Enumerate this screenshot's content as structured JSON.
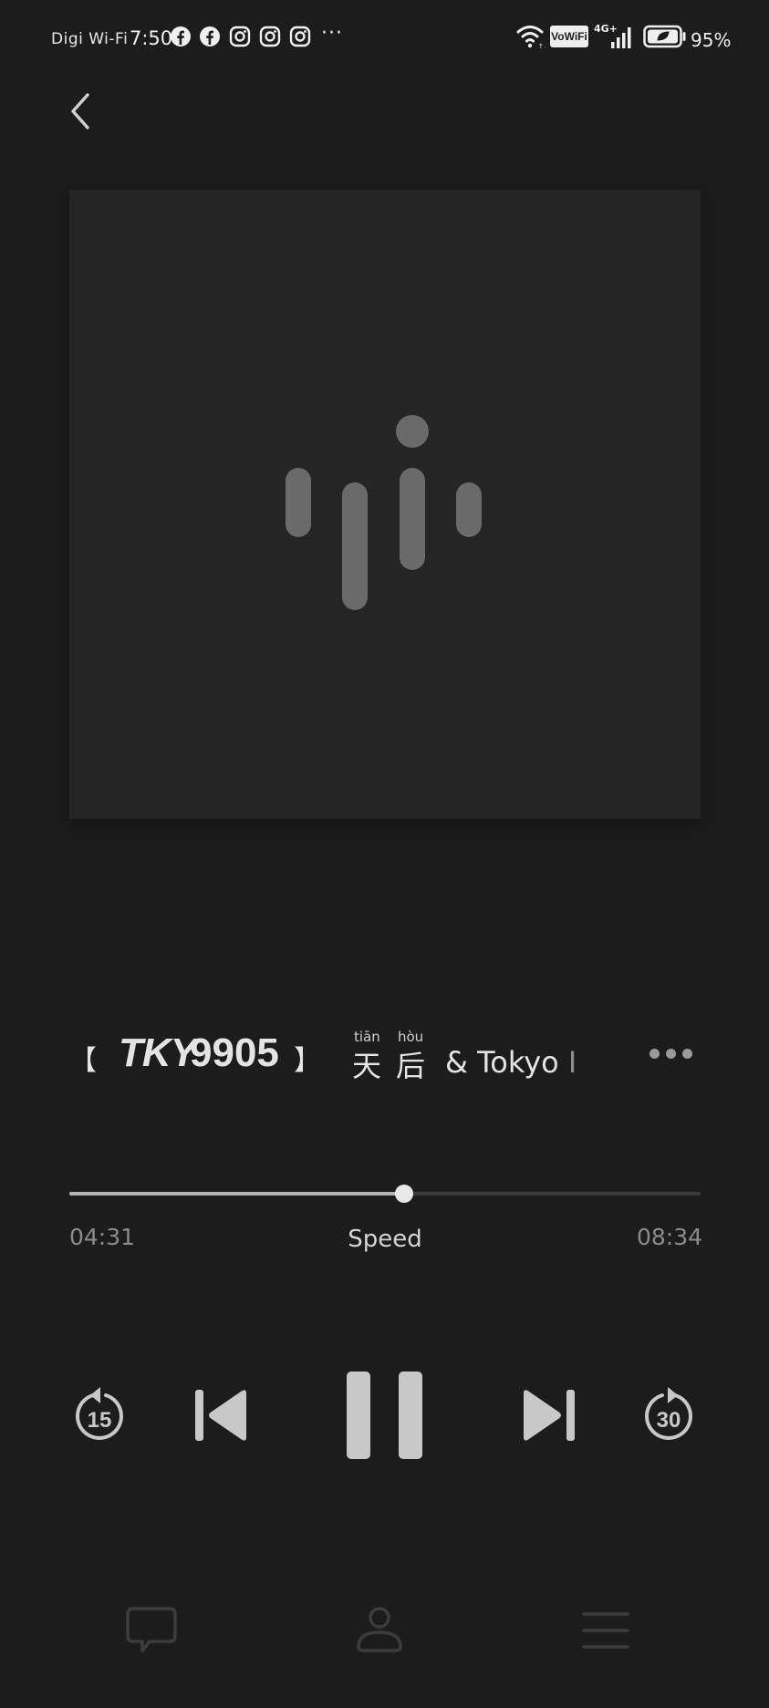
{
  "status_bar": {
    "carrier": "Digi Wi-Fi",
    "time": "7:50",
    "notifications": [
      "facebook-icon",
      "facebook-icon",
      "instagram-icon",
      "instagram-icon",
      "instagram-icon"
    ],
    "overflow": "···",
    "vowifi": "VoWiFi",
    "network": "4G+",
    "battery_percent": "95%"
  },
  "player": {
    "title_bracket_open": "【",
    "title_code_letters": "TKY",
    "title_code_digits": "9905",
    "title_bracket_close": "】",
    "title_hanzi_1": "天",
    "title_pinyin_1": "tiān",
    "title_hanzi_2": "后",
    "title_pinyin_2": "hòu",
    "title_rest": "& Tokyo I",
    "progress_fraction": 0.53,
    "elapsed": "04:31",
    "total": "08:34",
    "speed_label": "Speed",
    "rewind_seconds": "15",
    "forward_seconds": "30"
  },
  "colors": {
    "background": "#1c1c1c",
    "artwork_bg": "#252525",
    "logo_bars": "#6a6a6a",
    "controls": "#c8c8c8"
  },
  "bottom_nav": [
    "comment-icon",
    "profile-icon",
    "menu-icon"
  ]
}
